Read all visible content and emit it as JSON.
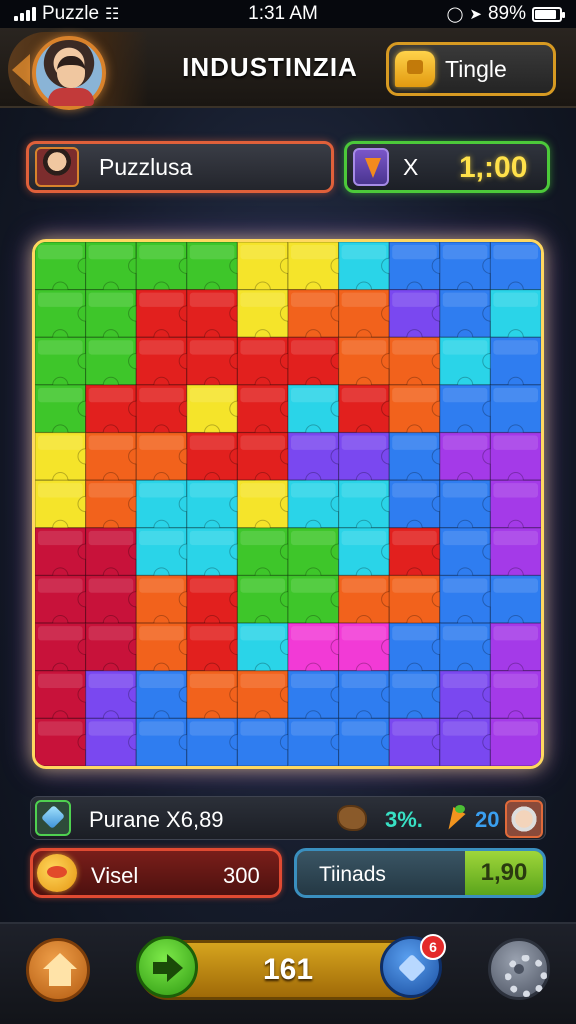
{
  "status_bar": {
    "carrier": "Puzzle",
    "time": "1:31 AM",
    "battery": "89%",
    "battery_level": 0.89
  },
  "header": {
    "title": "INDUSTINZIA",
    "action_label": "Tingle",
    "icons": [
      "back-arrow-icon",
      "avatar",
      "chat-icon"
    ]
  },
  "info_bar": {
    "player_name": "Puzzlusa",
    "multiplier": "X",
    "timer": "1,:00",
    "icons": [
      "player-avatar",
      "carrot-icon"
    ]
  },
  "board": {
    "cols": 10,
    "rows": 11,
    "colors": {
      "green": "#3ec62a",
      "yellow": "#f5e42a",
      "red": "#e2201e",
      "crimson": "#c8123a",
      "orange": "#f2621c",
      "cyan": "#2ad4e8",
      "blue": "#2f7df0",
      "purple": "#7a48f0",
      "violet": "#a43ae8",
      "magenta": "#f23ad6"
    },
    "grid": [
      [
        "green",
        "green",
        "green",
        "green",
        "yellow",
        "yellow",
        "cyan",
        "blue",
        "blue",
        "blue"
      ],
      [
        "green",
        "green",
        "red",
        "red",
        "yellow",
        "orange",
        "orange",
        "purple",
        "blue",
        "cyan"
      ],
      [
        "green",
        "green",
        "red",
        "red",
        "red",
        "red",
        "orange",
        "orange",
        "cyan",
        "blue"
      ],
      [
        "green",
        "red",
        "red",
        "yellow",
        "red",
        "cyan",
        "red",
        "orange",
        "blue",
        "blue"
      ],
      [
        "yellow",
        "orange",
        "orange",
        "red",
        "red",
        "purple",
        "purple",
        "blue",
        "violet",
        "violet"
      ],
      [
        "yellow",
        "orange",
        "cyan",
        "cyan",
        "yellow",
        "cyan",
        "cyan",
        "blue",
        "blue",
        "violet"
      ],
      [
        "crimson",
        "crimson",
        "cyan",
        "cyan",
        "green",
        "green",
        "cyan",
        "red",
        "blue",
        "violet"
      ],
      [
        "crimson",
        "crimson",
        "orange",
        "red",
        "green",
        "green",
        "orange",
        "orange",
        "blue",
        "blue"
      ],
      [
        "crimson",
        "crimson",
        "orange",
        "red",
        "cyan",
        "magenta",
        "magenta",
        "blue",
        "blue",
        "violet"
      ],
      [
        "crimson",
        "purple",
        "blue",
        "orange",
        "orange",
        "blue",
        "blue",
        "blue",
        "purple",
        "violet"
      ],
      [
        "crimson",
        "purple",
        "blue",
        "blue",
        "blue",
        "blue",
        "blue",
        "purple",
        "purple",
        "violet"
      ]
    ]
  },
  "stats": {
    "puzzle_label": "Purane X6,89",
    "percent": "3%.",
    "count": "20",
    "icons": [
      "gem-icon",
      "cookie-icon",
      "carrot-icon",
      "grandma-avatar"
    ]
  },
  "row2": {
    "left_label": "Visel",
    "left_value": "300",
    "right_label": "Tiinads",
    "right_value": "1,90",
    "icons": [
      "speech-bubble-icon"
    ]
  },
  "bottom_nav": {
    "progress_label": "161",
    "badge": "6",
    "icons": [
      "home-icon",
      "arrow-right-icon",
      "star-icon",
      "gear-icon"
    ]
  }
}
